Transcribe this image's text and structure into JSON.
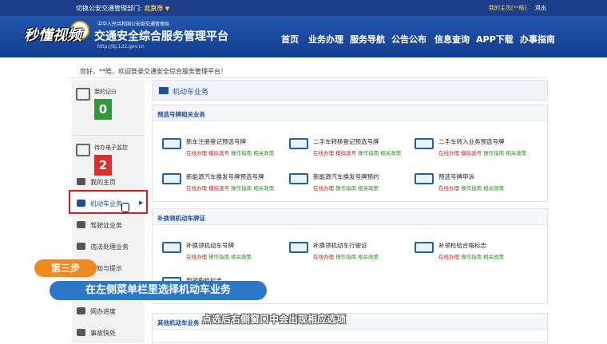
{
  "topbar": {
    "switch_label": "切换公安交通管理部门:",
    "city": "北京市",
    "caret": "▼",
    "my_home": "我的主页[**皓]",
    "logout": "退出"
  },
  "header": {
    "site_small": "中华人民共和国公安部交通管理局",
    "site_title": "交通安全综合服务管理平台",
    "site_url": "http://bj.122.gov.cn",
    "watermark": "秒懂视频"
  },
  "nav": [
    "首页",
    "业务办理",
    "服务导航",
    "公告公布",
    "信息查询",
    "APP下载",
    "办事指南"
  ],
  "welcome": "您好，**皓，欢迎登录交通安全综合服务管理平台！",
  "sidebar": {
    "cards": [
      {
        "label": "我的记分",
        "value": "0",
        "color": "#2f9a3a"
      },
      {
        "label": "待办电子监控",
        "value": "2",
        "color": "#d9302a"
      }
    ],
    "menu": [
      "我的主页",
      "机动车业务",
      "驾驶证业务",
      "违法处理业务",
      "告知与提示",
      "网办进度",
      "事故快处"
    ],
    "arrow": "▶"
  },
  "main": {
    "header": "机动车业务",
    "sections": [
      {
        "title": "预选号牌相关业务",
        "items": [
          {
            "title": "新车注册登记预选号牌",
            "links": [
              "在线办理",
              "模拟选号",
              "操作指南",
              "相关政策"
            ]
          },
          {
            "title": "二手车转移登记预选号牌",
            "links": [
              "在线办理",
              "模拟选号",
              "操作指南",
              "相关政策"
            ]
          },
          {
            "title": "二手车转入业务预选号牌",
            "links": [
              "在线办理",
              "模拟选号",
              "操作指南",
              "相关政策"
            ]
          },
          {
            "title": "新能源汽车换发号牌预选号牌",
            "links": [
              "在线办理",
              "模拟选号",
              "操作指南",
              "相关政策"
            ]
          },
          {
            "title": "新能源汽车换发号牌预约",
            "links": [
              "在线办理",
              "操作指南",
              "相关政策"
            ]
          },
          {
            "title": "预选号牌申诉",
            "links": [
              "在线办理",
              "操作指南",
              "相关政策"
            ]
          }
        ]
      },
      {
        "title": "补换领机动车牌证",
        "items": [
          {
            "title": "补换领机动车号牌",
            "links": [
              "在线办理",
              "操作指南",
              "相关政策"
            ]
          },
          {
            "title": "补换领机动车行驶证",
            "links": [
              "在线办理",
              "操作指南",
              "相关政策"
            ]
          },
          {
            "title": "补领检验合格标志",
            "links": [
              "在线办理",
              "操作指南",
              "相关政策"
            ]
          },
          {
            "title": "申领免检标志",
            "links": []
          }
        ]
      },
      {
        "title": "其他机动车业务",
        "items": []
      }
    ]
  },
  "captions": {
    "step": "第三步",
    "main": "在左侧菜单栏里选择机动车业务",
    "sub": "点选后右侧窗口中会出现相应选项"
  }
}
